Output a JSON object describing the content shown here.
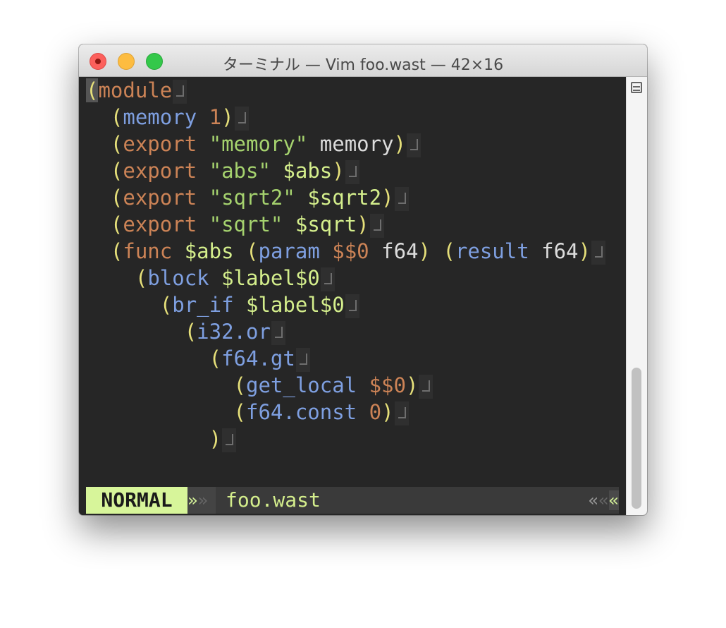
{
  "window": {
    "title": "ターミナル — Vim foo.wast — 42×16"
  },
  "editor": {
    "lines": [
      [
        {
          "t": "(",
          "c": "cursor"
        },
        {
          "t": "module",
          "c": "kw-orange"
        }
      ],
      [
        {
          "t": "  ",
          "c": "plain"
        },
        {
          "t": "(",
          "c": "paren"
        },
        {
          "t": "memory",
          "c": "kw-blue"
        },
        {
          "t": " ",
          "c": "plain"
        },
        {
          "t": "1",
          "c": "num"
        },
        {
          "t": ")",
          "c": "paren"
        }
      ],
      [
        {
          "t": "  ",
          "c": "plain"
        },
        {
          "t": "(",
          "c": "paren"
        },
        {
          "t": "export",
          "c": "kw-orange"
        },
        {
          "t": " ",
          "c": "plain"
        },
        {
          "t": "\"memory\"",
          "c": "str"
        },
        {
          "t": " memory",
          "c": "plain"
        },
        {
          "t": ")",
          "c": "paren"
        }
      ],
      [
        {
          "t": "  ",
          "c": "plain"
        },
        {
          "t": "(",
          "c": "paren"
        },
        {
          "t": "export",
          "c": "kw-orange"
        },
        {
          "t": " ",
          "c": "plain"
        },
        {
          "t": "\"abs\"",
          "c": "str"
        },
        {
          "t": " ",
          "c": "plain"
        },
        {
          "t": "$abs",
          "c": "var"
        },
        {
          "t": ")",
          "c": "paren"
        }
      ],
      [
        {
          "t": "  ",
          "c": "plain"
        },
        {
          "t": "(",
          "c": "paren"
        },
        {
          "t": "export",
          "c": "kw-orange"
        },
        {
          "t": " ",
          "c": "plain"
        },
        {
          "t": "\"sqrt2\"",
          "c": "str"
        },
        {
          "t": " ",
          "c": "plain"
        },
        {
          "t": "$sqrt2",
          "c": "var"
        },
        {
          "t": ")",
          "c": "paren"
        }
      ],
      [
        {
          "t": "  ",
          "c": "plain"
        },
        {
          "t": "(",
          "c": "paren"
        },
        {
          "t": "export",
          "c": "kw-orange"
        },
        {
          "t": " ",
          "c": "plain"
        },
        {
          "t": "\"sqrt\"",
          "c": "str"
        },
        {
          "t": " ",
          "c": "plain"
        },
        {
          "t": "$sqrt",
          "c": "var"
        },
        {
          "t": ")",
          "c": "paren"
        }
      ],
      [
        {
          "t": "  ",
          "c": "plain"
        },
        {
          "t": "(",
          "c": "paren"
        },
        {
          "t": "func",
          "c": "kw-orange"
        },
        {
          "t": " ",
          "c": "plain"
        },
        {
          "t": "$abs",
          "c": "var"
        },
        {
          "t": " ",
          "c": "plain"
        },
        {
          "t": "(",
          "c": "paren"
        },
        {
          "t": "param",
          "c": "kw-blue"
        },
        {
          "t": " ",
          "c": "plain"
        },
        {
          "t": "$$0",
          "c": "kw-orange"
        },
        {
          "t": " f64",
          "c": "plain"
        },
        {
          "t": ")",
          "c": "paren"
        },
        {
          "t": " ",
          "c": "plain"
        },
        {
          "t": "(",
          "c": "paren"
        },
        {
          "t": "result",
          "c": "kw-blue"
        },
        {
          "t": " f64",
          "c": "plain"
        },
        {
          "t": ")",
          "c": "paren"
        }
      ],
      [
        {
          "t": "    ",
          "c": "plain"
        },
        {
          "t": "(",
          "c": "paren"
        },
        {
          "t": "block",
          "c": "kw-blue"
        },
        {
          "t": " ",
          "c": "plain"
        },
        {
          "t": "$label$0",
          "c": "var"
        }
      ],
      [
        {
          "t": "      ",
          "c": "plain"
        },
        {
          "t": "(",
          "c": "paren"
        },
        {
          "t": "br_if",
          "c": "kw-blue"
        },
        {
          "t": " ",
          "c": "plain"
        },
        {
          "t": "$label$0",
          "c": "var"
        }
      ],
      [
        {
          "t": "        ",
          "c": "plain"
        },
        {
          "t": "(",
          "c": "paren"
        },
        {
          "t": "i32.or",
          "c": "kw-blue"
        }
      ],
      [
        {
          "t": "          ",
          "c": "plain"
        },
        {
          "t": "(",
          "c": "paren"
        },
        {
          "t": "f64.gt",
          "c": "kw-blue"
        }
      ],
      [
        {
          "t": "            ",
          "c": "plain"
        },
        {
          "t": "(",
          "c": "paren"
        },
        {
          "t": "get_local",
          "c": "kw-blue"
        },
        {
          "t": " ",
          "c": "plain"
        },
        {
          "t": "$$0",
          "c": "kw-orange"
        },
        {
          "t": ")",
          "c": "paren"
        }
      ],
      [
        {
          "t": "            ",
          "c": "plain"
        },
        {
          "t": "(",
          "c": "paren"
        },
        {
          "t": "f64.const",
          "c": "kw-blue"
        },
        {
          "t": " ",
          "c": "plain"
        },
        {
          "t": "0",
          "c": "num"
        },
        {
          "t": ")",
          "c": "paren"
        }
      ],
      [
        {
          "t": "          ",
          "c": "plain"
        },
        {
          "t": ")",
          "c": "paren"
        }
      ]
    ]
  },
  "statusline": {
    "mode": "NORMAL",
    "separator_right": "»",
    "separator_right_dim": "»",
    "filename": "foo.wast",
    "separator_left_1": "«",
    "separator_left_2": "«",
    "separator_left_3": "«"
  },
  "colors": {
    "background": "#262626",
    "keyword_orange": "#cc8356",
    "keyword_blue": "#7e9fe0",
    "string": "#a5d26e",
    "variable": "#d4ee8c",
    "paren": "#e6e07a",
    "mode_bg": "#d7f59a"
  }
}
